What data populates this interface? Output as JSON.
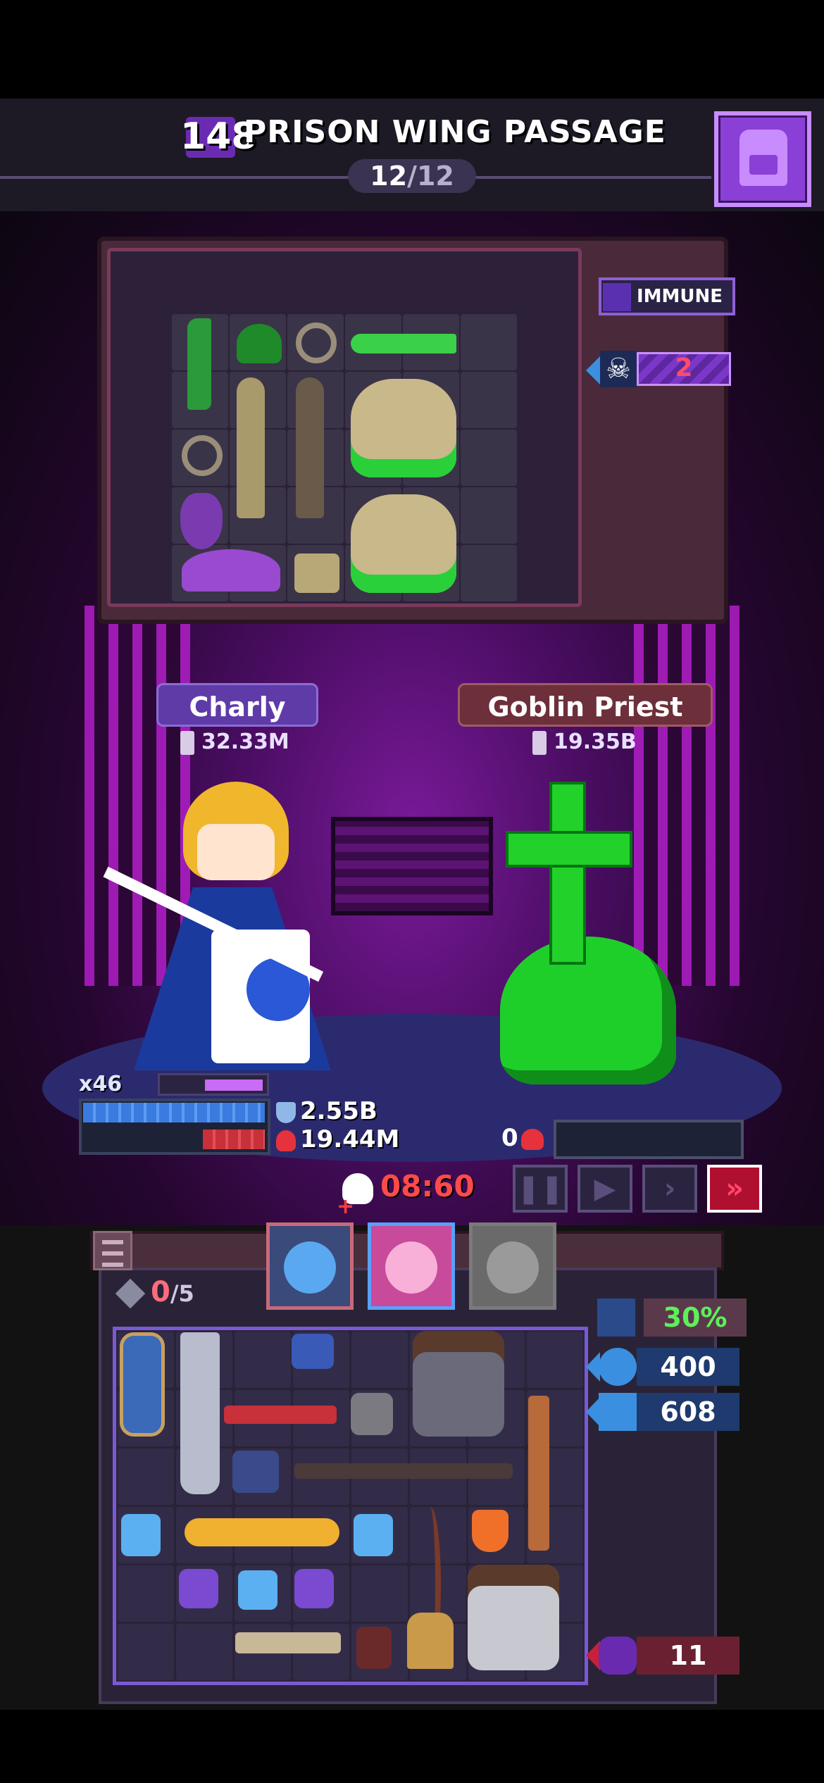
{
  "header": {
    "stage_number": "148",
    "stage_title": "PRISON WING PASSAGE",
    "wave_current": "12",
    "wave_total": "/12"
  },
  "enemy_panel": {
    "immune_label": "IMMUNE",
    "skull_count": "2"
  },
  "player": {
    "name": "Charly",
    "power": "32.33M",
    "combo": "x46",
    "shield": "2.55B",
    "health": "19.44M"
  },
  "enemy": {
    "name": "Goblin Priest",
    "power": "19.35B",
    "health": "0"
  },
  "battle": {
    "timer": "08:60",
    "speed_buttons": [
      "pause",
      "play",
      "fast",
      "fastest"
    ],
    "active_speed": "fastest"
  },
  "inventory": {
    "slots_used": "0",
    "slots_total": "/5",
    "heroes": [
      "blue-hero",
      "pink-hero",
      "locked-hero"
    ]
  },
  "side_stats": {
    "percent": "30%",
    "orbs": "400",
    "crosses": "608",
    "monsters": "11"
  },
  "colors": {
    "accent_purple": "#8a3fd6",
    "health_red": "#e6323c",
    "shield_blue": "#3a7be0",
    "poison_green": "#22d12a",
    "timer_red": "#ff4a4a"
  }
}
